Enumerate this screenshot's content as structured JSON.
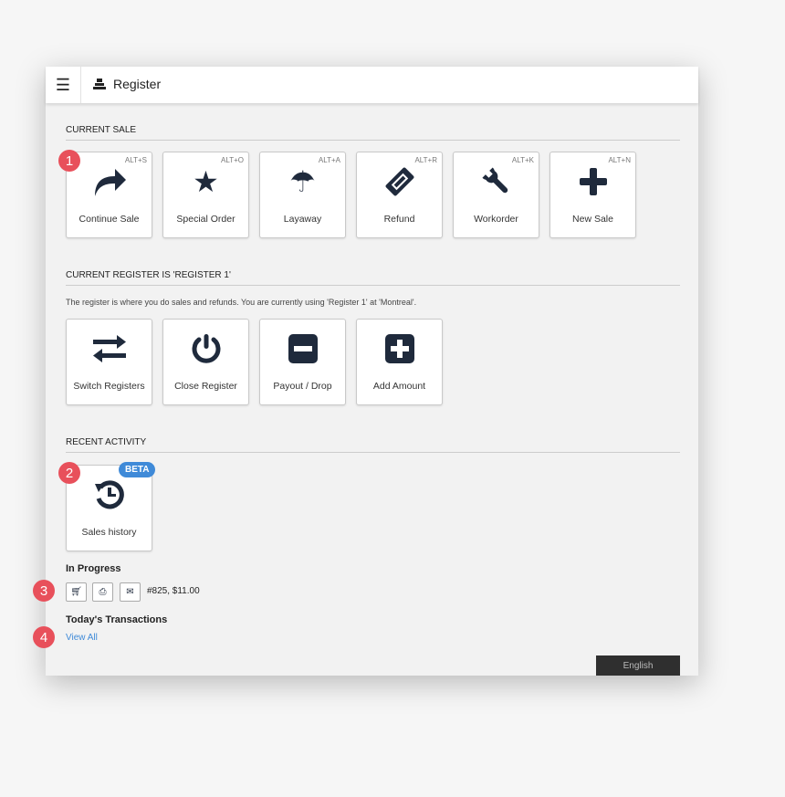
{
  "header": {
    "title": "Register"
  },
  "current_sale": {
    "heading": "CURRENT SALE",
    "tiles": [
      {
        "label": "Continue Sale",
        "shortcut": "ALT+S",
        "icon": "share-arrow-icon"
      },
      {
        "label": "Special Order",
        "shortcut": "ALT+O",
        "icon": "star-icon"
      },
      {
        "label": "Layaway",
        "shortcut": "ALT+A",
        "icon": "umbrella-icon"
      },
      {
        "label": "Refund",
        "shortcut": "ALT+R",
        "icon": "ticket-icon"
      },
      {
        "label": "Workorder",
        "shortcut": "ALT+K",
        "icon": "wrench-icon"
      },
      {
        "label": "New Sale",
        "shortcut": "ALT+N",
        "icon": "plus-icon"
      }
    ]
  },
  "register": {
    "heading": "CURRENT REGISTER IS 'REGISTER 1'",
    "description": "The register is where you do sales and refunds. You are currently using 'Register 1'  at 'Montreal'.",
    "tiles": [
      {
        "label": "Switch Registers",
        "icon": "exchange-icon"
      },
      {
        "label": "Close Register",
        "icon": "power-icon"
      },
      {
        "label": "Payout / Drop",
        "icon": "minus-square-icon"
      },
      {
        "label": "Add Amount",
        "icon": "plus-square-icon"
      }
    ]
  },
  "recent": {
    "heading": "RECENT ACTIVITY",
    "sales_history": "Sales history",
    "beta": "BETA",
    "in_progress": "In Progress",
    "in_progress_item": "#825, $11.00",
    "todays": "Today's Transactions",
    "view_all": "View All"
  },
  "badges": [
    "1",
    "2",
    "3",
    "4"
  ],
  "language": "English",
  "colors": {
    "badge": "#e8505b",
    "beta": "#3f8ad8",
    "link": "#3f8ad8",
    "icon": "#1f2a3c"
  }
}
